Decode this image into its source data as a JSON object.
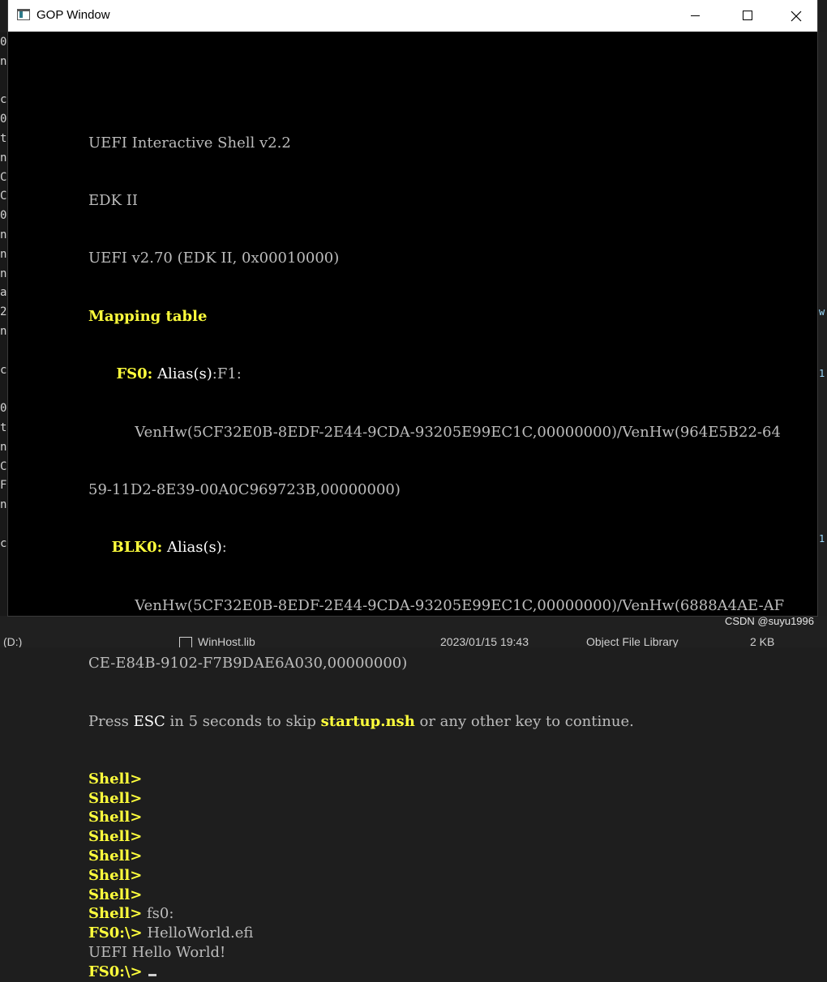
{
  "window": {
    "title": "GOP Window"
  },
  "console": {
    "header": [
      "UEFI Interactive Shell v2.2",
      "EDK II",
      "UEFI v2.70 (EDK II, 0x00010000)"
    ],
    "mapping_title": "Mapping table",
    "fs0": {
      "name": "FS0:",
      "alias_label": "Alias(s)",
      "alias_value": ":F1:",
      "path_line1": "VenHw(5CF32E0B-8EDF-2E44-9CDA-93205E99EC1C,00000000)/VenHw(964E5B22-64",
      "path_line2": "59-11D2-8E39-00A0C969723B,00000000)"
    },
    "blk0": {
      "name": "BLK0:",
      "alias_label": "Alias(s)",
      "alias_value": ":",
      "path_line1": "VenHw(5CF32E0B-8EDF-2E44-9CDA-93205E99EC1C,00000000)/VenHw(6888A4AE-AF",
      "path_line2": "CE-E84B-9102-F7B9DAE6A030,00000000)"
    },
    "press": {
      "prefix": "Press ",
      "key": "ESC",
      "middle": " in 5 seconds to skip ",
      "file": "startup.nsh",
      "suffix": " or any other key to continue."
    },
    "shell_prompt": "Shell>",
    "empty_prompt_count": 7,
    "cmd1": " fs0:",
    "fs_prompt": "FS0:\\>",
    "cmd2": " HelloWorld.efi",
    "output": "UEFI Hello World!"
  },
  "background": {
    "left_chars": [
      "0",
      "n",
      "",
      "c",
      "0",
      "t",
      "n",
      "C",
      "C",
      "0",
      "n",
      "n",
      "n",
      "a",
      "2",
      "n",
      "",
      "c",
      "",
      "0",
      "t",
      "n",
      "C",
      "F",
      "n",
      "",
      "c"
    ],
    "right_chars": [
      "w",
      "",
      "",
      "1",
      "",
      "",
      "",
      "",
      "",
      "",
      "",
      "1"
    ],
    "bottom": {
      "drive": "(D:)",
      "file": "WinHost.lib",
      "date": "2023/01/15 19:43",
      "type": "Object File Library",
      "size": "2 KB",
      "watermark": "CSDN @suyu1996"
    }
  }
}
